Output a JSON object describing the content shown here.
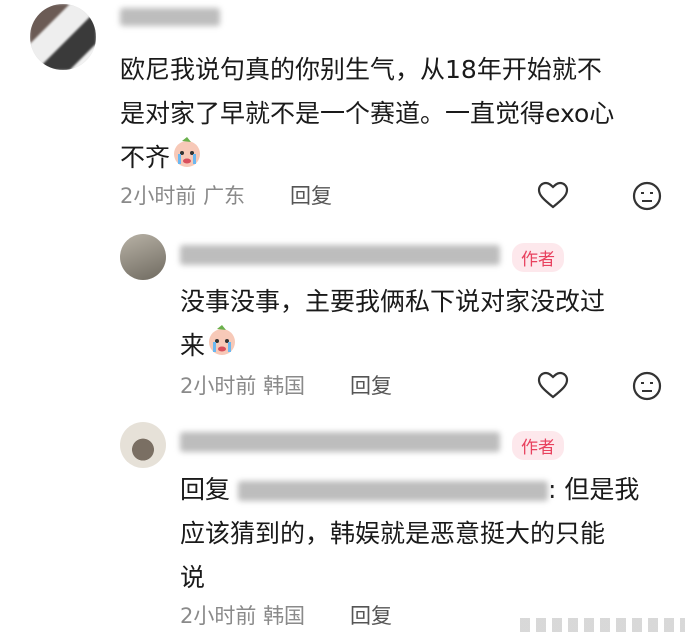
{
  "comments": [
    {
      "text_lines": [
        "欧尼我说句真的你别生气，从18年开始就不",
        "是对家了早就不是一个赛道。一直觉得exo心",
        "不齐"
      ],
      "time": "2小时前",
      "location": "广东",
      "reply_label": "回复",
      "icons": [
        "heart-icon",
        "emoji-face-icon"
      ]
    },
    {
      "author_badge": "作者",
      "text_lines": [
        "没事没事，主要我俩私下说对家没改过",
        "来"
      ],
      "time": "2小时前",
      "location": "韩国",
      "reply_label": "回复"
    },
    {
      "author_badge": "作者",
      "reply_prefix": "回复",
      "text_lines_tail": ": 但是我",
      "text_lines": [
        "应该猜到的，韩娱就是恶意挺大的只能",
        "说"
      ],
      "time": "2小时前",
      "location": "韩国",
      "reply_label": "回复"
    }
  ]
}
